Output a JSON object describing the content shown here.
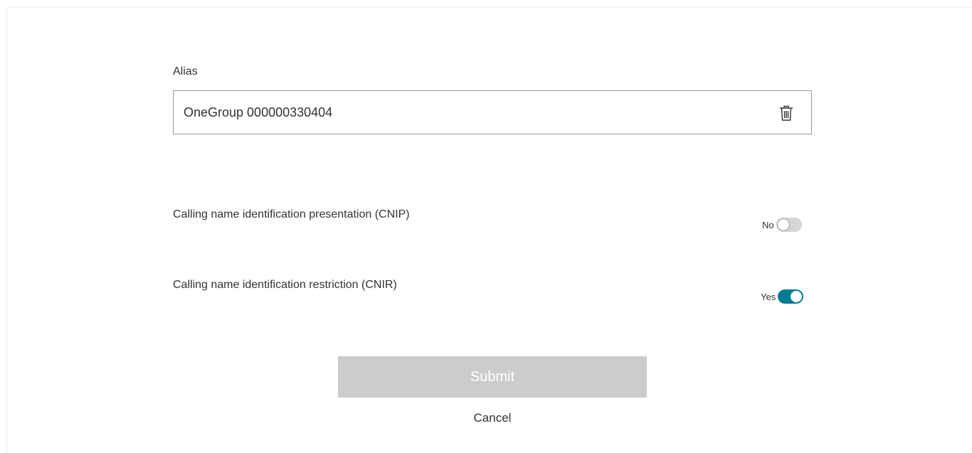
{
  "alias": {
    "label": "Alias",
    "value": "OneGroup 000000330404",
    "icon": "trash-icon"
  },
  "settings": [
    {
      "label": "Calling name identification presentation (CNIP)",
      "state_text": "No",
      "enabled": false
    },
    {
      "label": "Calling name identification restriction (CNIR)",
      "state_text": "Yes",
      "enabled": true
    }
  ],
  "actions": {
    "submit_label": "Submit",
    "submit_disabled": true,
    "cancel_label": "Cancel"
  },
  "colors": {
    "toggle_on": "#007c92",
    "toggle_off": "#d6d6d6",
    "submit_disabled_bg": "#cccccc"
  }
}
